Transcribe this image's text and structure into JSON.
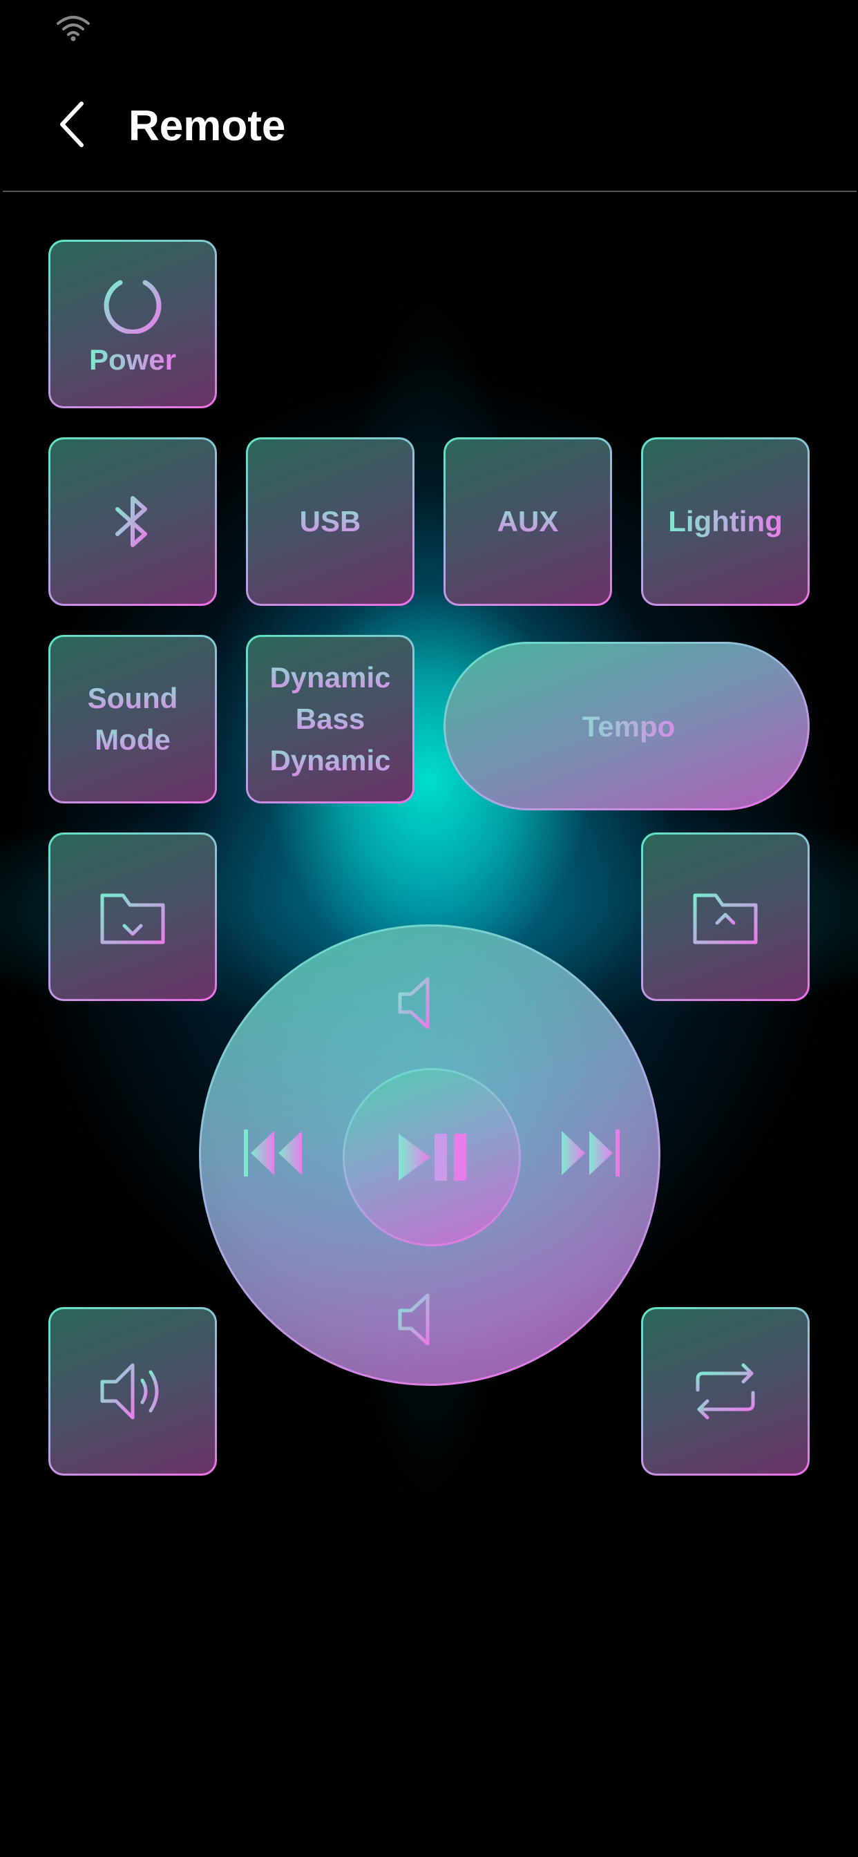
{
  "header": {
    "title": "Remote"
  },
  "buttons": {
    "power": "Power",
    "usb": "USB",
    "aux": "AUX",
    "lighting": "Lighting",
    "sound_mode_line1": "Sound",
    "sound_mode_line2": "Mode",
    "dynamic_bass_line1": "Dynamic",
    "dynamic_bass_line2": "Bass",
    "dynamic_bass_line3": "Dynamic",
    "tempo": "Tempo"
  },
  "icons": {
    "back": "chevron-left-icon",
    "wifi": "wifi-icon",
    "power": "power-icon",
    "bluetooth": "bluetooth-icon",
    "folder_down": "folder-download-icon",
    "folder_up": "folder-upload-icon",
    "volume_up": "volume-up-icon",
    "volume_down": "volume-down-icon",
    "previous": "skip-previous-icon",
    "next": "skip-next-icon",
    "play_pause": "play-pause-icon",
    "speaker": "speaker-icon",
    "repeat": "repeat-icon",
    "plus": "plus-icon",
    "minus": "minus-icon"
  },
  "colors": {
    "background": "#000000",
    "accent_teal": "#5fe3c4",
    "accent_pink": "#ee6fe6",
    "glow": "#00e6d2"
  }
}
